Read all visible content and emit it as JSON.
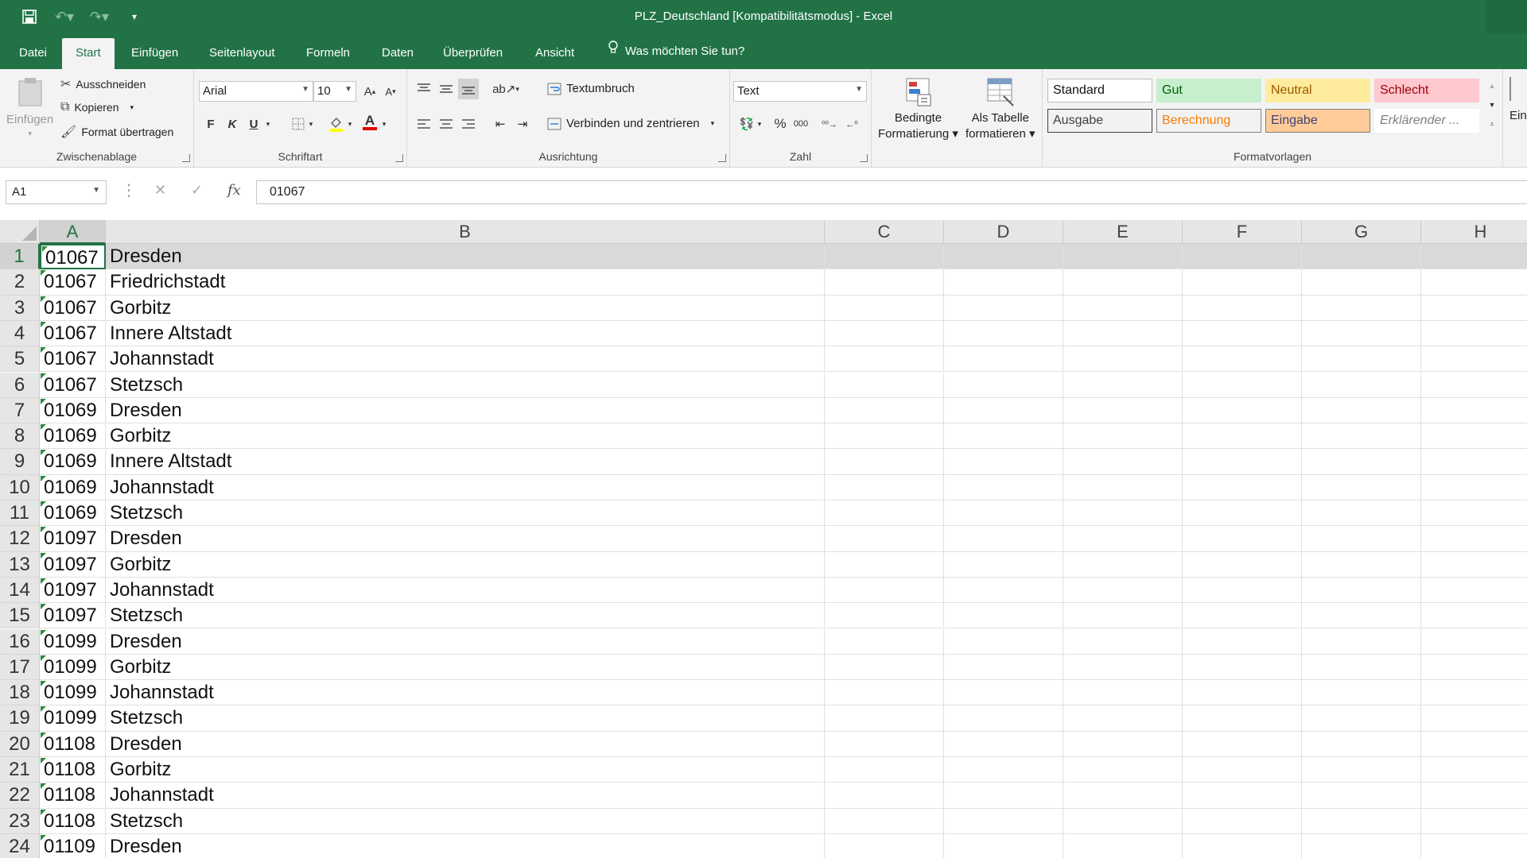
{
  "app": {
    "title": "PLZ_Deutschland  [Kompatibilitätsmodus]  -  Excel",
    "accent": "#217346"
  },
  "qat": {
    "save_icon": "save-icon",
    "undo_icon": "undo-icon",
    "redo_icon": "redo-icon",
    "customize_icon": "customize-qat-icon"
  },
  "tabs": [
    {
      "label": "Datei"
    },
    {
      "label": "Start"
    },
    {
      "label": "Einfügen"
    },
    {
      "label": "Seitenlayout"
    },
    {
      "label": "Formeln"
    },
    {
      "label": "Daten"
    },
    {
      "label": "Überprüfen"
    },
    {
      "label": "Ansicht"
    },
    {
      "label": "Was möchten Sie tun?"
    }
  ],
  "ribbon": {
    "clipboard": {
      "label": "Zwischenablage",
      "paste": "Einfügen",
      "cut": "Ausschneiden",
      "copy": "Kopieren",
      "format_painter": "Format übertragen"
    },
    "font": {
      "label": "Schriftart",
      "font_name": "Arial",
      "font_size": "10",
      "bold": "F",
      "italic": "K",
      "underline": "U"
    },
    "alignment": {
      "label": "Ausrichtung",
      "wrap_text": "Textumbruch",
      "merge_center": "Verbinden und zentrieren"
    },
    "number": {
      "label": "Zahl",
      "format": "Text"
    },
    "cond": {
      "line1": "Bedingte",
      "line2": "Formatierung"
    },
    "table": {
      "line1": "Als Tabelle",
      "line2": "formatieren"
    },
    "styles": {
      "label": "Formatvorlagen",
      "items": [
        {
          "name": "Standard",
          "bg": "#ffffff",
          "fg": "#111111",
          "border": "#bcbcbc"
        },
        {
          "name": "Gut",
          "bg": "#c6efce",
          "fg": "#006100",
          "border": "#c6efce"
        },
        {
          "name": "Neutral",
          "bg": "#ffeb9c",
          "fg": "#9c5700",
          "border": "#ffeb9c"
        },
        {
          "name": "Schlecht",
          "bg": "#ffc7ce",
          "fg": "#9c0006",
          "border": "#ffc7ce"
        },
        {
          "name": "Ausgabe",
          "bg": "#f2f2f2",
          "fg": "#3f3f3f",
          "border": "#3f3f3f"
        },
        {
          "name": "Berechnung",
          "bg": "#f2f2f2",
          "fg": "#fa7d00",
          "border": "#7f7f7f"
        },
        {
          "name": "Eingabe",
          "bg": "#ffcc99",
          "fg": "#3f3f76",
          "border": "#7f7f7f"
        },
        {
          "name": "Erklärender ...",
          "bg": "#ffffff",
          "fg": "#7f7f7f",
          "border": "#ffffff"
        }
      ]
    },
    "cells_partial": "Ein"
  },
  "formula_bar": {
    "name_box": "A1",
    "fx": "fx",
    "value": "01067"
  },
  "columns": [
    {
      "name": "A"
    },
    {
      "name": "B"
    },
    {
      "name": "C"
    },
    {
      "name": "D"
    },
    {
      "name": "E"
    },
    {
      "name": "F"
    },
    {
      "name": "G"
    },
    {
      "name": "H"
    }
  ],
  "rows": [
    {
      "n": "1",
      "a": "01067",
      "b": "Dresden"
    },
    {
      "n": "2",
      "a": "01067",
      "b": "Friedrichstadt"
    },
    {
      "n": "3",
      "a": "01067",
      "b": "Gorbitz"
    },
    {
      "n": "4",
      "a": "01067",
      "b": "Innere Altstadt"
    },
    {
      "n": "5",
      "a": "01067",
      "b": "Johannstadt"
    },
    {
      "n": "6",
      "a": "01067",
      "b": "Stetzsch"
    },
    {
      "n": "7",
      "a": "01069",
      "b": "Dresden"
    },
    {
      "n": "8",
      "a": "01069",
      "b": "Gorbitz"
    },
    {
      "n": "9",
      "a": "01069",
      "b": "Innere Altstadt"
    },
    {
      "n": "10",
      "a": "01069",
      "b": "Johannstadt"
    },
    {
      "n": "11",
      "a": "01069",
      "b": "Stetzsch"
    },
    {
      "n": "12",
      "a": "01097",
      "b": "Dresden"
    },
    {
      "n": "13",
      "a": "01097",
      "b": "Gorbitz"
    },
    {
      "n": "14",
      "a": "01097",
      "b": "Johannstadt"
    },
    {
      "n": "15",
      "a": "01097",
      "b": "Stetzsch"
    },
    {
      "n": "16",
      "a": "01099",
      "b": "Dresden"
    },
    {
      "n": "17",
      "a": "01099",
      "b": "Gorbitz"
    },
    {
      "n": "18",
      "a": "01099",
      "b": "Johannstadt"
    },
    {
      "n": "19",
      "a": "01099",
      "b": "Stetzsch"
    },
    {
      "n": "20",
      "a": "01108",
      "b": "Dresden"
    },
    {
      "n": "21",
      "a": "01108",
      "b": "Gorbitz"
    },
    {
      "n": "22",
      "a": "01108",
      "b": "Johannstadt"
    },
    {
      "n": "23",
      "a": "01108",
      "b": "Stetzsch"
    },
    {
      "n": "24",
      "a": "01109",
      "b": "Dresden"
    }
  ]
}
